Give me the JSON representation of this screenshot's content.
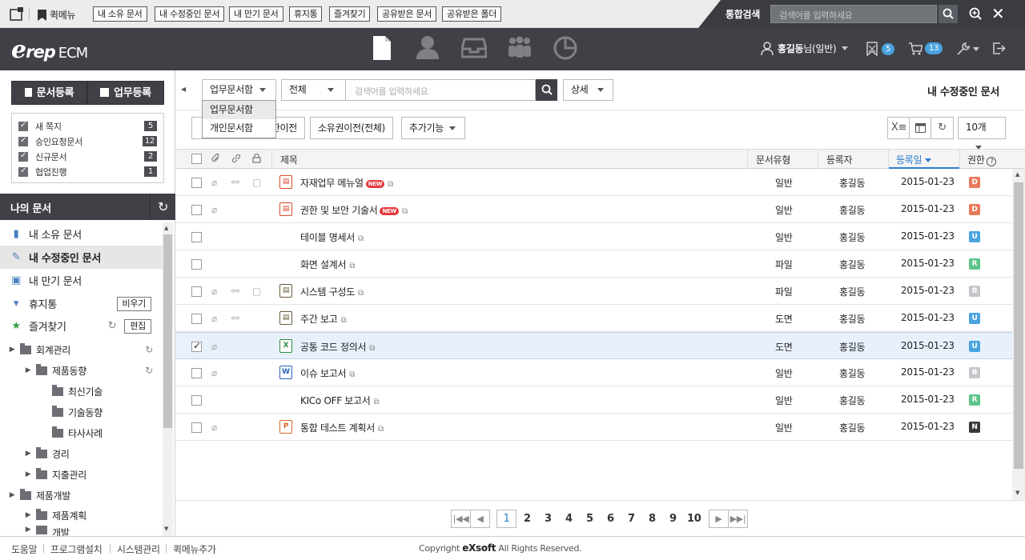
{
  "quickbar": {
    "label": "퀵메뉴",
    "buttons": [
      "내 소유 문서",
      "내 수정중인 문서",
      "내 만기 문서",
      "휴지통",
      "즐겨찾기",
      "공유받은 문서",
      "공유받은 폴더"
    ]
  },
  "search": {
    "title": "통합검색",
    "placeholder": "검색어를 입력하세요"
  },
  "header": {
    "logo_e": "e",
    "logo_rep": "rep",
    "logo_ecm": "ECM",
    "user_name": "홍길동",
    "user_role": "님(일반)",
    "badge_approval": "5",
    "badge_cart": "13"
  },
  "sidebar": {
    "register_doc": "문서등록",
    "register_work": "업무등록",
    "notices": [
      {
        "label": "새 쪽지",
        "count": "5"
      },
      {
        "label": "승인요청문서",
        "count": "12"
      },
      {
        "label": "신규문서",
        "count": "2"
      },
      {
        "label": "협업진행",
        "count": "1"
      }
    ],
    "section_title": "나의 문서",
    "nav": [
      {
        "label": "내 소유 문서"
      },
      {
        "label": "내 수정중인 문서"
      },
      {
        "label": "내 만기 문서"
      },
      {
        "label": "휴지통",
        "button": "비우기"
      },
      {
        "label": "즐겨찾기",
        "button": "편집"
      }
    ],
    "tree": [
      "회계관리",
      "제품동향",
      "최신기술",
      "기술동향",
      "타사사례",
      "경리",
      "지출관리",
      "제품개발",
      "제품계획",
      "개발"
    ]
  },
  "toolbar": {
    "scope_select": "업무문서함",
    "scope_options": [
      "업무문서함",
      "개인문서함"
    ],
    "filter_select": "전체",
    "search_placeholder": "검색어를 입력하세요",
    "detail_select": "상세",
    "page_title": "내 수정중인 문서",
    "btn_partial": "한이전",
    "btn_transfer": "소유권이전(전체)",
    "btn_more": "추가기능",
    "page_size": "10개"
  },
  "table": {
    "headers": {
      "title": "제목",
      "type": "문서유형",
      "author": "등록자",
      "date": "등록일",
      "perm": "권한"
    },
    "rows": [
      {
        "title": "자재업무 메뉴얼",
        "new": "NEW",
        "type": "일반",
        "author": "홍길동",
        "date": "2015-01-23",
        "perm": "D",
        "file": "PDF"
      },
      {
        "title": "권한 및 보안 기술서",
        "new": "NEW",
        "type": "일반",
        "author": "홍길동",
        "date": "2015-01-23",
        "perm": "D",
        "file": "PDF"
      },
      {
        "title": "테이블 명세서",
        "type": "일반",
        "author": "홍길동",
        "date": "2015-01-23",
        "perm": "U",
        "file": ""
      },
      {
        "title": "화면 설계서",
        "type": "파일",
        "author": "홍길동",
        "date": "2015-01-23",
        "perm": "R",
        "file": ""
      },
      {
        "title": "시스템 구성도",
        "type": "파일",
        "author": "홍길동",
        "date": "2015-01-23",
        "perm": "B",
        "file": "DOC"
      },
      {
        "title": "주간 보고",
        "type": "도면",
        "author": "홍길동",
        "date": "2015-01-23",
        "perm": "U",
        "file": "DOC"
      },
      {
        "title": "공통 코드 정의서",
        "type": "도면",
        "author": "홍길동",
        "date": "2015-01-23",
        "perm": "U",
        "file": "XLS"
      },
      {
        "title": "이슈 보고서",
        "type": "일반",
        "author": "홍길동",
        "date": "2015-01-23",
        "perm": "B",
        "file": "W"
      },
      {
        "title": "KICo OFF 보고서",
        "type": "일반",
        "author": "홍길동",
        "date": "2015-01-23",
        "perm": "R",
        "file": ""
      },
      {
        "title": "통합 테스트 계획서",
        "type": "일반",
        "author": "홍길동",
        "date": "2015-01-23",
        "perm": "N",
        "file": "P"
      }
    ]
  },
  "pagination": {
    "pages": [
      "1",
      "2",
      "3",
      "4",
      "5",
      "6",
      "7",
      "8",
      "9",
      "10"
    ],
    "current": "1"
  },
  "footer": {
    "links": [
      "도움말",
      "프로그램설치",
      "시스템관리",
      "퀵메뉴추가"
    ],
    "copyright_prefix": "Copyright ",
    "copyright_brand": "eXsoft",
    "copyright_suffix": " All Rights Reserved."
  },
  "colors": {
    "perm_D": "#e8795a",
    "perm_U": "#4aa3df",
    "perm_R": "#5bc48a",
    "perm_B": "#c4c6ca",
    "perm_N": "#3a3a3a",
    "accent": "#2e7dd1",
    "dark": "#3f4147"
  }
}
